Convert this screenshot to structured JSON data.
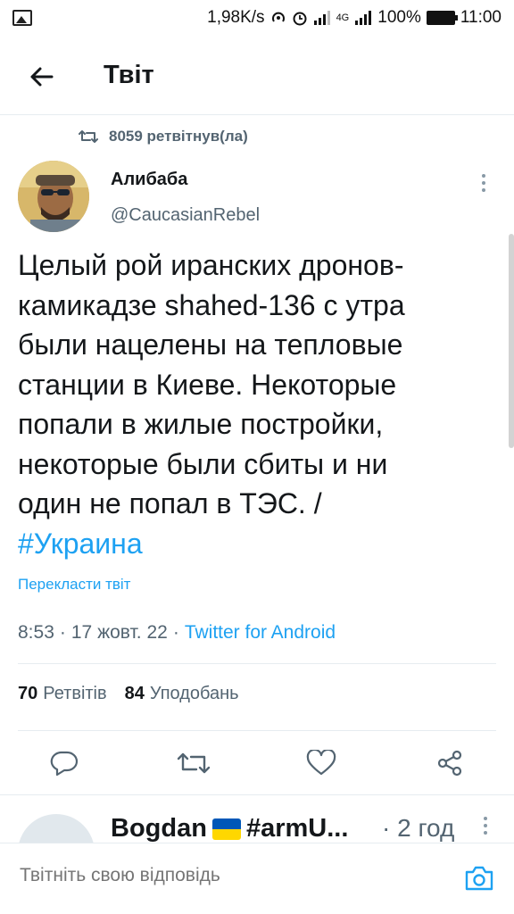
{
  "status_bar": {
    "speed": "1,98K/s",
    "network": "4G",
    "battery": "100%",
    "time": "11:00"
  },
  "header": {
    "title": "Твіт",
    "back_icon": "arrow-left-icon"
  },
  "retweet_context": {
    "text": "8059 ретвітнув(ла)",
    "icon": "retweet-icon"
  },
  "tweet": {
    "author_name": "Алибаба",
    "author_handle": "@CaucasianRebel",
    "text_lines": [
      "Целый рой иранских дронов-",
      "камикадзе shahed-136 с утра",
      "были нацелены на тепловые",
      "станции в Киеве. Некоторые",
      "попали в жилые постройки,",
      "некоторые были сбиты и ни",
      "один не попал в ТЭС. /"
    ],
    "hashtag": "#Украина",
    "translate": "Перекласти твіт",
    "time": "8:53",
    "date": "17 жовт. 22",
    "source": "Twitter for Android",
    "sep": "·"
  },
  "stats": {
    "retweets_count": "70",
    "retweets_label": "Ретвітів",
    "likes_count": "84",
    "likes_label": "Уподобань"
  },
  "actions": {
    "reply_icon": "reply-icon",
    "retweet_icon": "retweet-icon",
    "like_icon": "heart-icon",
    "share_icon": "share-icon"
  },
  "reply": {
    "name_start": "Bogdan",
    "name_end": "#armU...",
    "time": "· 2 год"
  },
  "compose": {
    "placeholder": "Твітніть свою відповідь"
  },
  "colors": {
    "accent": "#1da1f2",
    "secondary_text": "#536471"
  }
}
